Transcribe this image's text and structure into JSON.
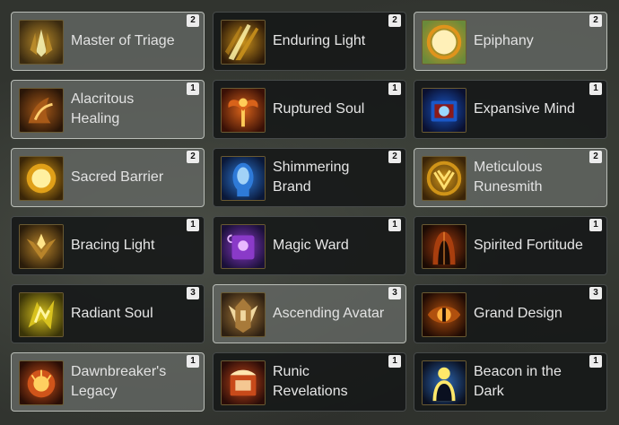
{
  "talents": [
    {
      "name": "Master of Triage",
      "rank": "2",
      "active": true,
      "icon": "praying-hands-icon",
      "colors": [
        "#f4f0b0",
        "#b88a2a",
        "#3a2a10"
      ]
    },
    {
      "name": "Enduring Light",
      "rank": "2",
      "active": false,
      "icon": "light-beams-icon",
      "colors": [
        "#fff4a8",
        "#c8901c",
        "#2e1a08"
      ]
    },
    {
      "name": "Epiphany",
      "rank": "2",
      "active": true,
      "icon": "radiant-orb-icon",
      "colors": [
        "#fff0b8",
        "#e0941c",
        "#6a8a3a"
      ]
    },
    {
      "name": "Alacritous Healing",
      "rank": "1",
      "active": true,
      "icon": "glowing-hands-icon",
      "colors": [
        "#ffd070",
        "#a85a18",
        "#2a1608"
      ]
    },
    {
      "name": "Ruptured Soul",
      "rank": "1",
      "active": false,
      "icon": "flame-wings-icon",
      "colors": [
        "#ffcc58",
        "#d8621a",
        "#3a1006"
      ]
    },
    {
      "name": "Expansive Mind",
      "rank": "1",
      "active": false,
      "icon": "arcane-book-icon",
      "colors": [
        "#9ad8ff",
        "#1a58c8",
        "#0a1030"
      ]
    },
    {
      "name": "Sacred Barrier",
      "rank": "2",
      "active": true,
      "icon": "sun-sphere-icon",
      "colors": [
        "#fff0a0",
        "#e0a018",
        "#3a2608"
      ]
    },
    {
      "name": "Shimmering Brand",
      "rank": "2",
      "active": false,
      "icon": "spectral-face-icon",
      "colors": [
        "#bfe8ff",
        "#2e7ad8",
        "#0a1838"
      ]
    },
    {
      "name": "Meticulous Runesmith",
      "rank": "2",
      "active": true,
      "icon": "golden-rune-icon",
      "colors": [
        "#ffe070",
        "#d09418",
        "#3a2408"
      ]
    },
    {
      "name": "Bracing Light",
      "rank": "1",
      "active": false,
      "icon": "holy-emblem-icon",
      "colors": [
        "#ffe488",
        "#b8842a",
        "#2a1c0a"
      ]
    },
    {
      "name": "Magic Ward",
      "rank": "1",
      "active": false,
      "icon": "scroll-icon",
      "colors": [
        "#e8b8ff",
        "#8a3ac8",
        "#1a1038"
      ]
    },
    {
      "name": "Spirited Fortitude",
      "rank": "1",
      "active": false,
      "icon": "hooded-figure-icon",
      "colors": [
        "#ff9a3a",
        "#a83e0e",
        "#1a0a04"
      ]
    },
    {
      "name": "Radiant Soul",
      "rank": "3",
      "active": false,
      "icon": "golden-glyph-icon",
      "colors": [
        "#fff6a0",
        "#d8c21e",
        "#3a3408"
      ]
    },
    {
      "name": "Ascending Avatar",
      "rank": "3",
      "active": true,
      "icon": "avatar-armor-icon",
      "colors": [
        "#f0d8a0",
        "#a87a3a",
        "#2e2012"
      ]
    },
    {
      "name": "Grand Design",
      "rank": "3",
      "active": false,
      "icon": "eye-sigil-icon",
      "colors": [
        "#ffb040",
        "#b0500e",
        "#1e0a04"
      ]
    },
    {
      "name": "Dawnbreaker's Legacy",
      "rank": "1",
      "active": true,
      "icon": "burning-orb-icon",
      "colors": [
        "#ffd060",
        "#d0541a",
        "#2a0e06"
      ]
    },
    {
      "name": "Runic Revelations",
      "rank": "1",
      "active": false,
      "icon": "runic-tome-icon",
      "colors": [
        "#ffe6b0",
        "#c84a1a",
        "#2a0c08"
      ]
    },
    {
      "name": "Beacon in the Dark",
      "rank": "1",
      "active": false,
      "icon": "beacon-silhouette-icon",
      "colors": [
        "#ffe86a",
        "#2f6ab8",
        "#0a1020"
      ]
    }
  ]
}
